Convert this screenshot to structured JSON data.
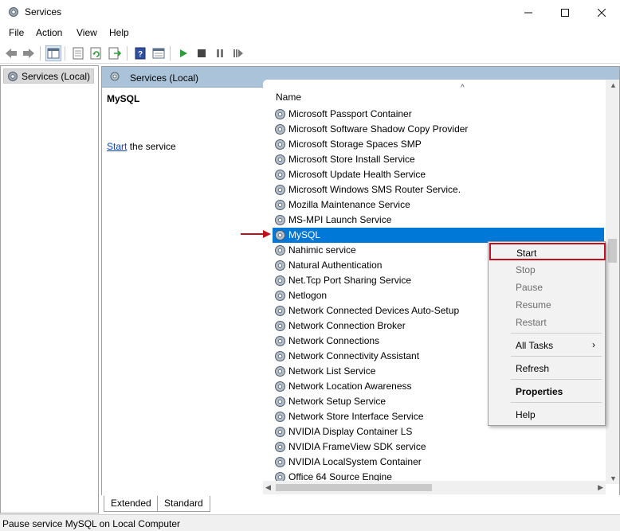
{
  "window": {
    "title": "Services"
  },
  "menu": [
    "File",
    "Action",
    "View",
    "Help"
  ],
  "tree": {
    "root": "Services (Local)"
  },
  "right_header": "Services (Local)",
  "description": {
    "title": "MySQL",
    "link": "Start",
    "rest": "the service"
  },
  "list": {
    "column": "Name",
    "rows": [
      "Microsoft Passport Container",
      "Microsoft Software Shadow Copy Provider",
      "Microsoft Storage Spaces SMP",
      "Microsoft Store Install Service",
      "Microsoft Update Health Service",
      "Microsoft Windows SMS Router Service.",
      "Mozilla Maintenance Service",
      "MS-MPI Launch Service",
      "MySQL",
      "Nahimic service",
      "Natural Authentication",
      "Net.Tcp Port Sharing Service",
      "Netlogon",
      "Network Connected Devices Auto-Setup",
      "Network Connection Broker",
      "Network Connections",
      "Network Connectivity Assistant",
      "Network List Service",
      "Network Location Awareness",
      "Network Setup Service",
      "Network Store Interface Service",
      "NVIDIA Display Container LS",
      "NVIDIA FrameView SDK service",
      "NVIDIA LocalSystem Container",
      "Office 64 Source Engine"
    ],
    "selected": "MySQL"
  },
  "context_menu": {
    "start": "Start",
    "stop": "Stop",
    "pause": "Pause",
    "resume": "Resume",
    "restart": "Restart",
    "all_tasks": "All Tasks",
    "refresh": "Refresh",
    "properties": "Properties",
    "help": "Help"
  },
  "tabs": [
    "Extended",
    "Standard"
  ],
  "status": "Pause service MySQL on Local Computer",
  "colors": {
    "selection": "#0078d7",
    "header": "#aac3d8",
    "highlight": "#c0101b",
    "arrow": "#c0101b"
  }
}
